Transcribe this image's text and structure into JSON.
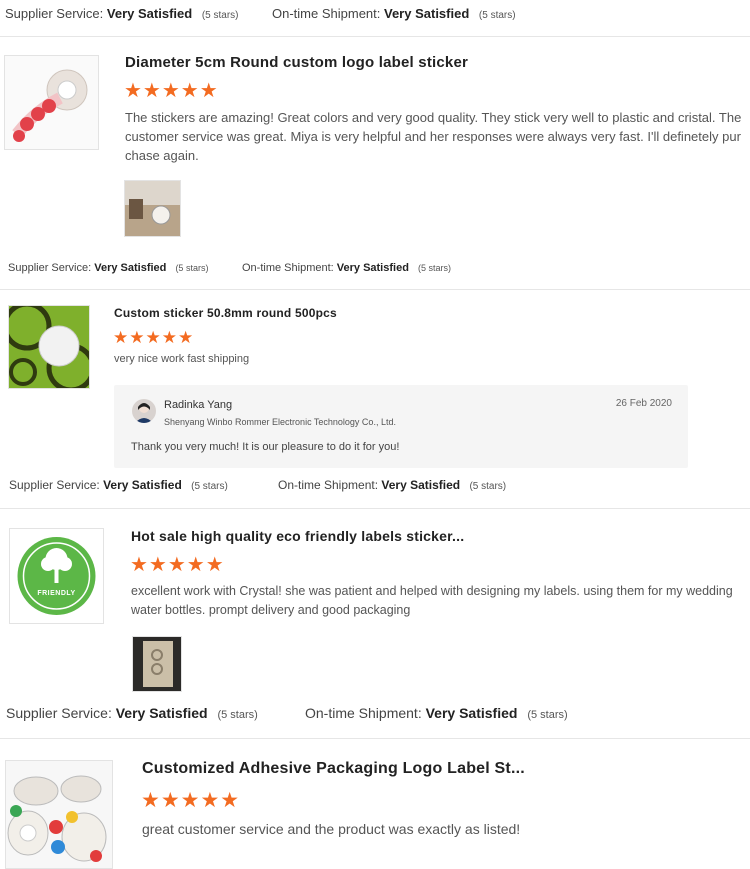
{
  "labels": {
    "supplier_service": "Supplier Service:",
    "on_time_shipment": "On-time Shipment:",
    "very_satisfied": "Very Satisfied",
    "five_stars": "(5 stars)"
  },
  "star_glyphs": "★★★★★",
  "reviews": [
    {
      "product_title": "Diameter 5cm Round custom logo label sticker",
      "stars": 5,
      "review_text": "The stickers are amazing! Great colors and very good quality. They stick very well to plastic and cristal. The customer service was great. Miya is very helpful and her responses were always very fast. I'll definetely pur chase again.",
      "product_icon": "round-sticker-roll-image",
      "attached_photo_icon": "customer-photo"
    },
    {
      "product_title": "Custom sticker 50.8mm round 500pcs",
      "stars": 5,
      "review_text": "very nice work fast shipping",
      "product_icon": "green-round-sticker-image",
      "reply": {
        "name": "Radinka Yang",
        "company": "Shenyang Winbo Rommer Electronic Technology Co., Ltd.",
        "date": "26 Feb 2020",
        "text": "Thank you very much! It is our pleasure to do it for you!"
      }
    },
    {
      "product_title": "Hot sale high quality eco friendly labels sticker...",
      "stars": 5,
      "review_text": "excellent work with Crystal! she was patient and helped with designing my labels. using them for my wedding water bottles. prompt delivery and good packaging",
      "product_icon": "friendly-tree-label-image",
      "label_text": "FRIENDLY",
      "attached_photo_icon": "customer-photo"
    },
    {
      "product_title": "Customized Adhesive Packaging Logo Label St...",
      "stars": 5,
      "review_text": "great customer service and the product was exactly as listed!",
      "product_icon": "label-rolls-image"
    }
  ],
  "colors": {
    "star": "#f36b21",
    "divider": "#e6e6e6",
    "reply_bg": "#f5f5f5",
    "eco_green": "#5cb747"
  }
}
